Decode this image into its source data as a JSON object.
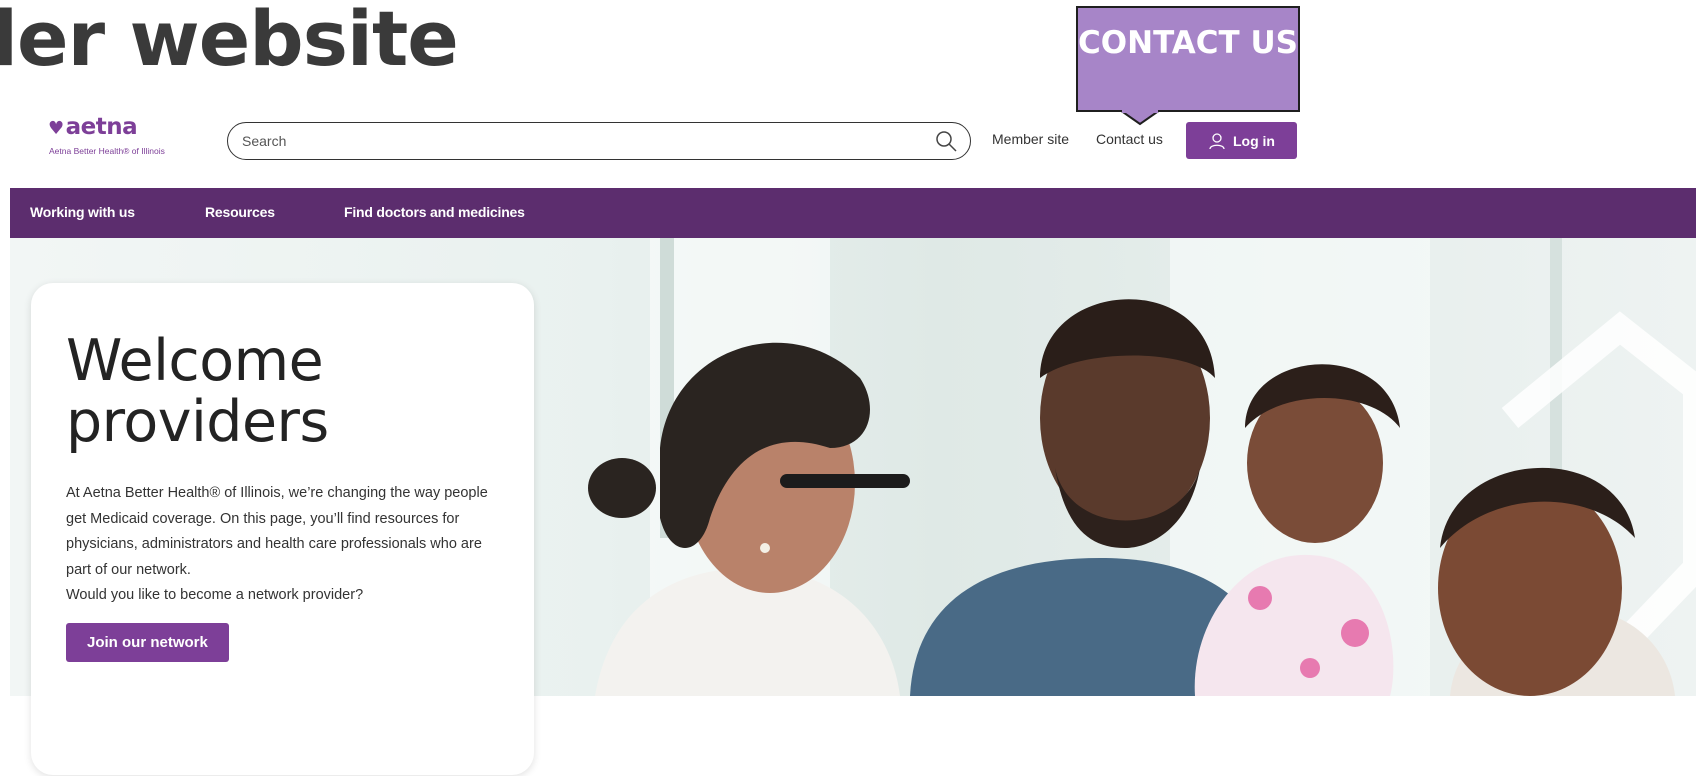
{
  "overlay": {
    "heading_fragment": "ler website",
    "callout_text": "CONTACT US"
  },
  "brand": {
    "logo_text": "aetna",
    "tagline": "Aetna Better Health® of Illinois",
    "primary_color": "#7d3f98",
    "nav_color": "#5c2d6e"
  },
  "header": {
    "search_placeholder": "Search",
    "member_site": "Member site",
    "contact_us": "Contact us",
    "login_label": "Log in",
    "icons": [
      "search-icon",
      "user-icon"
    ]
  },
  "nav": {
    "items": [
      {
        "label": "Working with us"
      },
      {
        "label": "Resources"
      },
      {
        "label": "Find doctors and medicines"
      }
    ]
  },
  "hero": {
    "title": "Welcome providers",
    "body": "At Aetna Better Health® of Illinois, we’re changing the way people get Medicaid coverage. On this page, you’ll find resources for physicians, administrators and health care professionals who are part of our network.",
    "question": "Would you like to become a network provider?",
    "cta": "Join our network"
  }
}
